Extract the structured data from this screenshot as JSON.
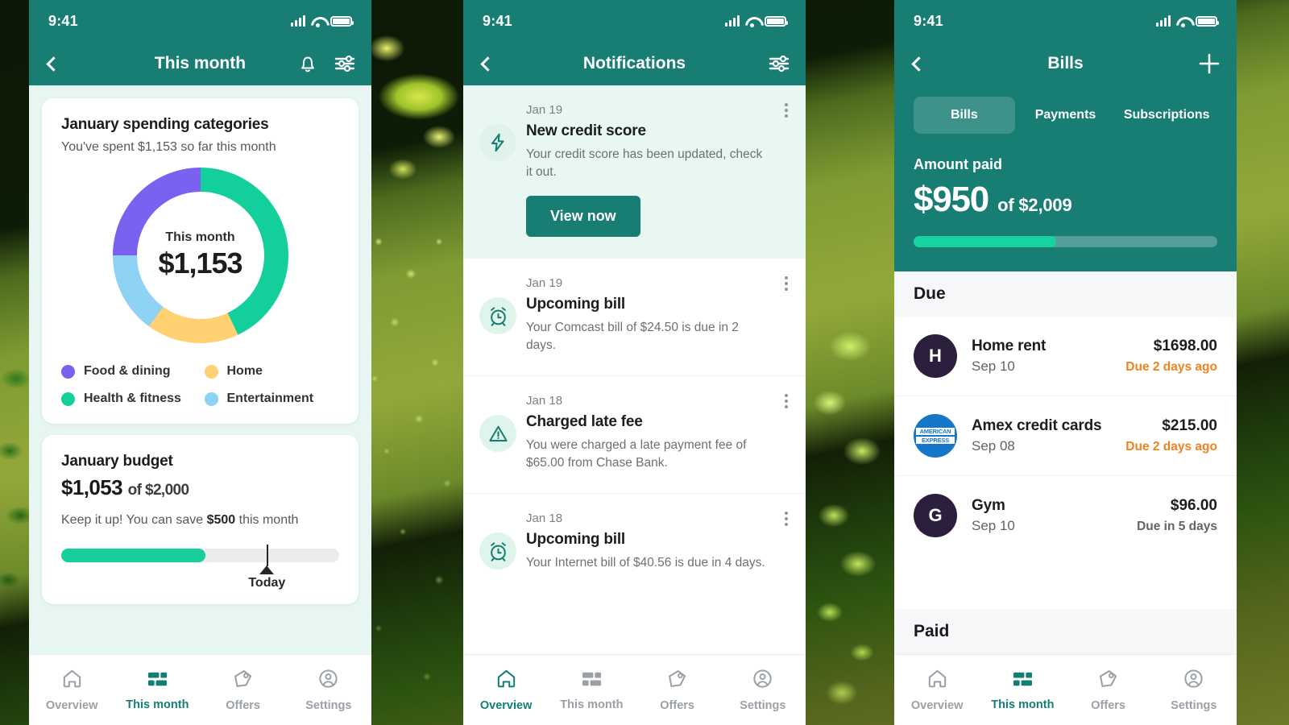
{
  "theme": {
    "teal": "#187e74",
    "mint_bg": "#e8f6f3",
    "green_accent": "#16cf9c",
    "overdue_orange": "#ef8321"
  },
  "status_bar": {
    "time": "9:41"
  },
  "nav_items": [
    {
      "label": "Overview",
      "icon": "home-icon"
    },
    {
      "label": "This month",
      "icon": "cards-icon"
    },
    {
      "label": "Offers",
      "icon": "offers-icon"
    },
    {
      "label": "Settings",
      "icon": "account-icon"
    }
  ],
  "panel_this_month": {
    "appbar": {
      "title": "This month",
      "back_icon": "chevron-left-icon",
      "bell_icon": "bell-icon",
      "filter_icon": "sliders-icon"
    },
    "spending_card": {
      "title": "January spending categories",
      "subtitle": "You've spent $1,153 so far this month",
      "donut_center_label": "This month",
      "donut_center_amount": "$1,153"
    },
    "budget_card": {
      "title": "January budget",
      "spent": "$1,053",
      "of_text": "of $2,000",
      "note_prefix": "Keep it up! You can save ",
      "note_amount": "$500",
      "note_suffix": " this month",
      "progress_percent": 52,
      "today_marker_percent": 74,
      "today_label": "Today"
    },
    "active_nav": "This month"
  },
  "chart_data": {
    "type": "pie",
    "title": "January spending categories",
    "center_label": "This month",
    "center_value": "$1,153",
    "total": 1153,
    "categories": [
      "Health & fitness",
      "Home",
      "Entertainment",
      "Food & dining"
    ],
    "values": [
      43,
      17,
      15,
      25
    ],
    "unit": "percent",
    "colors": [
      "#13cf9c",
      "#ffd173",
      "#8ed2f4",
      "#7b61f0"
    ],
    "legend": [
      {
        "label": "Food & dining",
        "color": "#7b61f0",
        "percent": 25
      },
      {
        "label": "Home",
        "color": "#ffd173",
        "percent": 17
      },
      {
        "label": "Health & fitness",
        "color": "#13cf9c",
        "percent": 43
      },
      {
        "label": "Entertainment",
        "color": "#8ed2f4",
        "percent": 15
      }
    ],
    "legend_position": "bottom",
    "donut": true,
    "start_angle_deg": 0
  },
  "panel_notifications": {
    "appbar": {
      "title": "Notifications",
      "back_icon": "chevron-left-icon",
      "filter_icon": "sliders-icon"
    },
    "items": [
      {
        "date": "Jan 19",
        "title": "New credit score",
        "desc": "Your credit score has been updated, check it out.",
        "icon": "lightning-bolt-icon",
        "unread": true,
        "action_label": "View now"
      },
      {
        "date": "Jan 19",
        "title": "Upcoming bill",
        "desc": "Your Comcast bill of $24.50 is due in 2 days.",
        "icon": "alarm-clock-icon",
        "unread": false,
        "action_label": ""
      },
      {
        "date": "Jan 18",
        "title": "Charged late fee",
        "desc": "You were charged a late payment fee of $65.00 from Chase Bank.",
        "icon": "warning-triangle-icon",
        "unread": false,
        "action_label": ""
      },
      {
        "date": "Jan 18",
        "title": "Upcoming bill",
        "desc": "Your Internet bill of $40.56 is due in 4 days.",
        "icon": "alarm-clock-icon",
        "unread": false,
        "action_label": ""
      }
    ],
    "active_nav": "Overview"
  },
  "panel_bills": {
    "appbar": {
      "title": "Bills",
      "back_icon": "chevron-left-icon",
      "add_icon": "plus-icon"
    },
    "tabs": [
      {
        "label": "Bills",
        "active": true
      },
      {
        "label": "Payments",
        "active": false
      },
      {
        "label": "Subscriptions",
        "active": false
      }
    ],
    "amount_paid_label": "Amount paid",
    "amount_paid": "$950",
    "amount_total": "of $2,009",
    "paid_percent": 47,
    "due_section_title": "Due",
    "paid_section_title": "Paid",
    "due_items": [
      {
        "avatar_type": "letter",
        "avatar_text": "H",
        "avatar_color": "#2b1f3d",
        "name": "Home rent",
        "date": "Sep 10",
        "amount": "$1698.00",
        "status": "Due 2 days ago",
        "status_kind": "overdue"
      },
      {
        "avatar_type": "amex",
        "avatar_text": "AMERICAN EXPRESS",
        "avatar_color": "#1577c8",
        "avatar_line1": "AMERICAN",
        "avatar_line2": "EXPRESS",
        "name": "Amex credit cards",
        "date": "Sep 08",
        "amount": "$215.00",
        "status": "Due 2 days ago",
        "status_kind": "overdue"
      },
      {
        "avatar_type": "letter",
        "avatar_text": "G",
        "avatar_color": "#2b1f3d",
        "name": "Gym",
        "date": "Sep 10",
        "amount": "$96.00",
        "status": "Due in 5 days",
        "status_kind": "upcoming"
      }
    ],
    "active_nav": "This month"
  }
}
